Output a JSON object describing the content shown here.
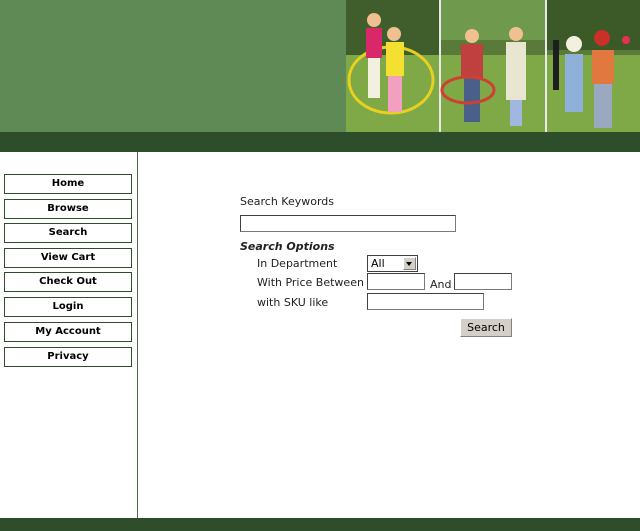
{
  "colors": {
    "banner": "#5f8a55",
    "dark_bar": "#2e4d2a",
    "button_face": "#d4d0c8"
  },
  "sidebar": {
    "items": [
      {
        "label": "Home"
      },
      {
        "label": "Browse"
      },
      {
        "label": "Search"
      },
      {
        "label": "View Cart"
      },
      {
        "label": "Check Out"
      },
      {
        "label": "Login"
      },
      {
        "label": "My Account"
      },
      {
        "label": "Privacy"
      }
    ]
  },
  "search": {
    "keywords_label": "Search Keywords",
    "keywords_value": "",
    "options_heading": "Search Options",
    "department_label": "In Department",
    "department_value": "All",
    "price_label": "With Price Between",
    "price_and_label": "And",
    "price_min_value": "",
    "price_max_value": "",
    "sku_label": "with SKU like",
    "sku_value": "",
    "button_label": "Search"
  }
}
